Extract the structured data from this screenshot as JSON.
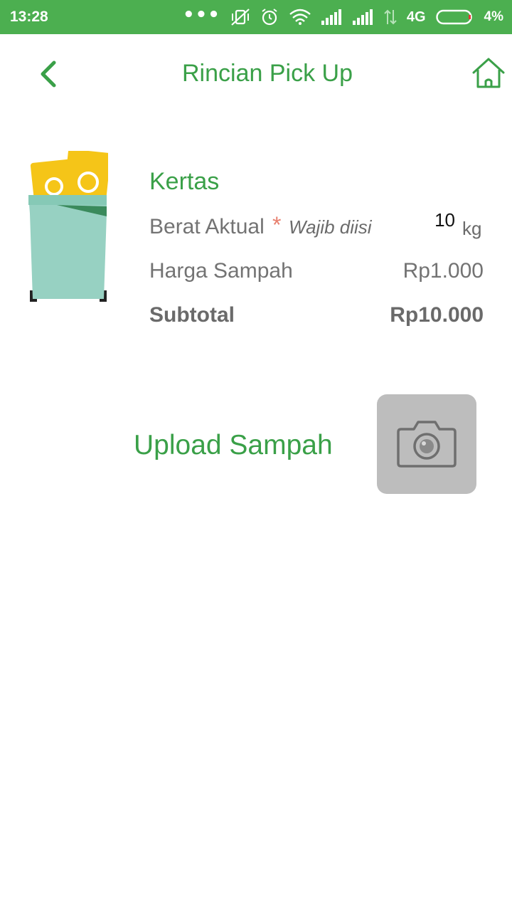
{
  "status_bar": {
    "time": "13:28",
    "network": "4G",
    "battery": "4%",
    "background": "#4caf50"
  },
  "header": {
    "title": "Rincian Pick Up",
    "back_icon": "chevron-left-icon",
    "home_icon": "home-icon"
  },
  "item": {
    "name": "Kertas",
    "image_icon": "trash-bin-with-paper-icon",
    "weight_label": "Berat Aktual",
    "required_marker": "*",
    "required_note": "Wajib diisi",
    "weight_value": "10",
    "weight_unit": "kg",
    "price_label": "Harga Sampah",
    "price_value": "Rp1.000",
    "subtotal_label": "Subtotal",
    "subtotal_value": "Rp10.000"
  },
  "upload": {
    "label": "Upload Sampah",
    "button_icon": "camera-icon"
  },
  "colors": {
    "accent": "#3aa048",
    "text_gray": "#737373",
    "required": "#e8806f",
    "camera_bg": "#bdbdbd"
  }
}
